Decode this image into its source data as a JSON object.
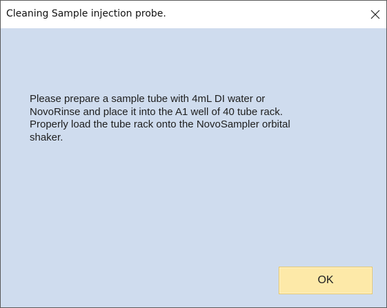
{
  "dialog": {
    "title": "Cleaning Sample injection probe.",
    "message_lines": [
      "Please prepare a sample tube with 4mL DI water or",
      "NovoRinse and place it into the A1 well of 40 tube rack.",
      "Properly load the tube rack onto the NovoSampler orbital",
      "shaker."
    ],
    "ok_label": "OK",
    "close_icon": "close-icon"
  },
  "colors": {
    "background": "#cfdcee",
    "ok_button": "#fde9a8",
    "titlebar": "#ffffff"
  }
}
